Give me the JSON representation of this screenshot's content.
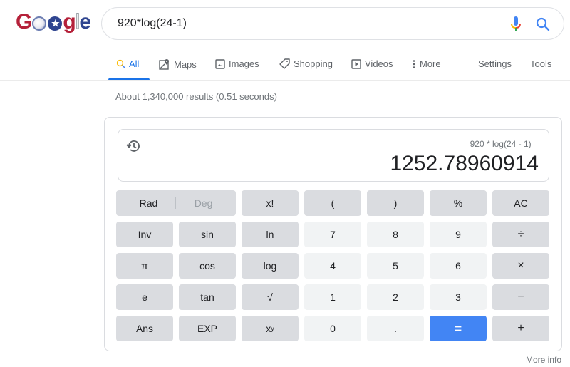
{
  "logo": {
    "text": "Google",
    "letters": [
      "G",
      "o",
      "o",
      "g",
      "l",
      "e"
    ]
  },
  "search": {
    "query": "920*log(24-1)",
    "mic_icon": "microphone-icon",
    "search_icon": "magnifier-icon"
  },
  "tabs": [
    {
      "label": "All",
      "icon": "search-icon",
      "active": true
    },
    {
      "label": "Maps",
      "icon": "map-pin-icon",
      "active": false
    },
    {
      "label": "Images",
      "icon": "image-icon",
      "active": false
    },
    {
      "label": "Shopping",
      "icon": "tag-icon",
      "active": false
    },
    {
      "label": "Videos",
      "icon": "play-icon",
      "active": false
    },
    {
      "label": "More",
      "icon": "more-vert-icon",
      "active": false
    }
  ],
  "tools": {
    "settings": "Settings",
    "tools": "Tools"
  },
  "result_stats": "About 1,340,000 results (0.51 seconds)",
  "calculator": {
    "expression": "920 * log(24 - 1) =",
    "result": "1252.78960914",
    "history_icon": "history-icon",
    "mode": {
      "rad": "Rad",
      "deg": "Deg",
      "selected": "Rad"
    },
    "keys": {
      "fact": "x!",
      "lparen": "(",
      "rparen": ")",
      "percent": "%",
      "ac": "AC",
      "inv": "Inv",
      "sin": "sin",
      "ln": "ln",
      "seven": "7",
      "eight": "8",
      "nine": "9",
      "divide": "÷",
      "pi": "π",
      "cos": "cos",
      "log": "log",
      "four": "4",
      "five": "5",
      "six": "6",
      "multiply": "×",
      "e": "e",
      "tan": "tan",
      "sqrt": "√",
      "one": "1",
      "two": "2",
      "three": "3",
      "minus": "−",
      "ans": "Ans",
      "exp": "EXP",
      "pow_base": "x",
      "pow_sup": "y",
      "zero": "0",
      "dot": ".",
      "equals": "=",
      "plus": "+"
    }
  },
  "more_info": "More info",
  "colors": {
    "accent": "#1a73e8",
    "equals_button": "#4285f4",
    "func_key": "#dadce0",
    "num_key": "#f1f3f4"
  }
}
